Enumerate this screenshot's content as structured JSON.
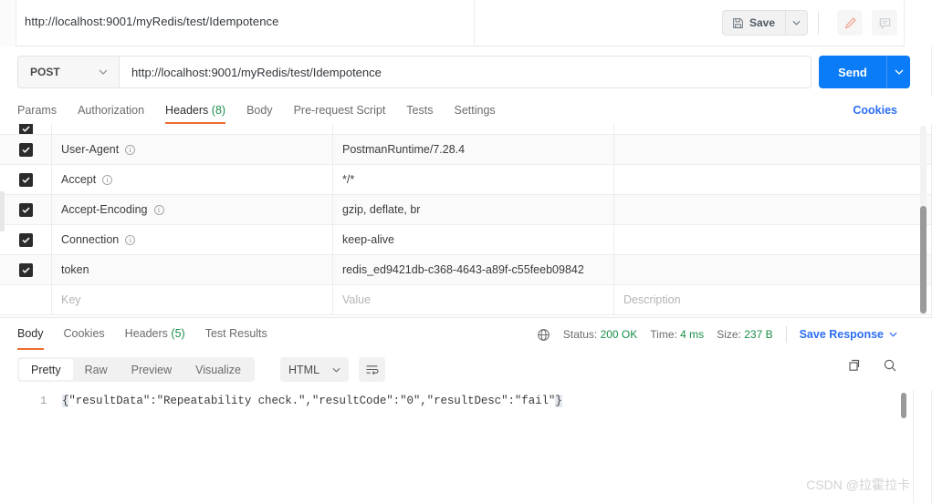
{
  "topbar": {
    "url_title": "http://localhost:9001/myRedis/test/Idempotence",
    "save_label": "Save",
    "save_caret_icon": "chevron-down-icon",
    "floppy_icon": "floppy-disk-icon",
    "edit_icon": "pencil-icon",
    "comment_icon": "comment-icon"
  },
  "request": {
    "method": "POST",
    "method_caret_icon": "chevron-down-icon",
    "url": "http://localhost:9001/myRedis/test/Idempotence",
    "send_label": "Send",
    "send_caret_icon": "chevron-down-icon"
  },
  "request_tabs": {
    "items": [
      {
        "label": "Params",
        "active": false
      },
      {
        "label": "Authorization",
        "active": false
      },
      {
        "label": "Headers",
        "count": "(8)",
        "active": true
      },
      {
        "label": "Body",
        "active": false
      },
      {
        "label": "Pre-request Script",
        "active": false
      },
      {
        "label": "Tests",
        "active": false
      },
      {
        "label": "Settings",
        "active": false
      }
    ],
    "cookies_link": "Cookies"
  },
  "headers_table": {
    "columns": [
      "Key",
      "Value",
      "Description"
    ],
    "rows": [
      {
        "checked": true,
        "key": "User-Agent",
        "info": true,
        "value": "PostmanRuntime/7.28.4",
        "description": ""
      },
      {
        "checked": true,
        "key": "Accept",
        "info": true,
        "value": "*/*",
        "description": ""
      },
      {
        "checked": true,
        "key": "Accept-Encoding",
        "info": true,
        "value": "gzip, deflate, br",
        "description": ""
      },
      {
        "checked": true,
        "key": "Connection",
        "info": true,
        "value": "keep-alive",
        "description": ""
      },
      {
        "checked": true,
        "key": "token",
        "info": false,
        "value": "redis_ed9421db-c368-4643-a89f-c55feeb09842",
        "description": ""
      }
    ],
    "placeholder_row": {
      "key": "Key",
      "value": "Value",
      "description": "Description"
    }
  },
  "response_tabs": {
    "items": [
      {
        "label": "Body",
        "active": true
      },
      {
        "label": "Cookies",
        "active": false
      },
      {
        "label": "Headers",
        "count": "(5)",
        "active": false
      },
      {
        "label": "Test Results",
        "active": false
      }
    ]
  },
  "response_status": {
    "globe_icon": "globe-icon",
    "status_label": "Status:",
    "status_value": "200 OK",
    "time_label": "Time:",
    "time_value": "4 ms",
    "size_label": "Size:",
    "size_value": "237 B",
    "save_response_label": "Save Response",
    "save_response_caret_icon": "chevron-down-icon"
  },
  "format_bar": {
    "modes": [
      {
        "label": "Pretty",
        "active": true
      },
      {
        "label": "Raw",
        "active": false
      },
      {
        "label": "Preview",
        "active": false
      },
      {
        "label": "Visualize",
        "active": false
      }
    ],
    "language": "HTML",
    "language_caret_icon": "chevron-down-icon",
    "wrap_icon": "wrap-lines-icon",
    "copy_icon": "copy-icon",
    "search_icon": "search-icon"
  },
  "response_body": {
    "line_number": "1",
    "open_brace": "{",
    "content": "\"resultData\":\"Repeatability check.\",\"resultCode\":\"0\",\"resultDesc\":\"fail\"",
    "close_brace": "}"
  },
  "watermark": "CSDN @拉霍拉卡",
  "colors": {
    "accent_orange": "#ef6c2f",
    "link_blue": "#2c6ef2",
    "send_blue": "#0a7cf7",
    "status_green": "#1a8f4a"
  }
}
